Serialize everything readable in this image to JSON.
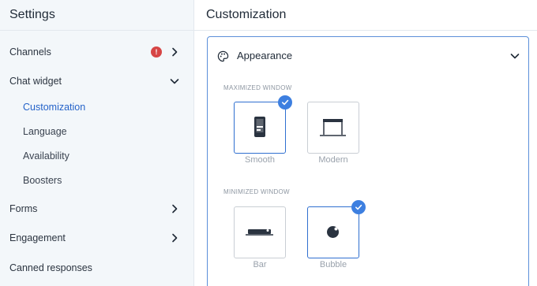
{
  "sidebar": {
    "title": "Settings",
    "items": [
      {
        "label": "Channels",
        "badge": "!"
      },
      {
        "label": "Chat widget"
      },
      {
        "label": "Customization",
        "active": true
      },
      {
        "label": "Language"
      },
      {
        "label": "Availability"
      },
      {
        "label": "Boosters"
      },
      {
        "label": "Forms"
      },
      {
        "label": "Engagement"
      },
      {
        "label": "Canned responses"
      }
    ]
  },
  "main": {
    "title": "Customization",
    "panel": {
      "title": "Appearance",
      "maximized": {
        "label": "MAXIMIZED WINDOW",
        "options": [
          {
            "label": "Smooth",
            "selected": true
          },
          {
            "label": "Modern",
            "selected": false
          }
        ]
      },
      "minimized": {
        "label": "MINIMIZED WINDOW",
        "options": [
          {
            "label": "Bar",
            "selected": false
          },
          {
            "label": "Bubble",
            "selected": true
          }
        ]
      }
    }
  },
  "colors": {
    "accent": "#2563c9",
    "check": "#3d7fe0",
    "badge": "#d64545",
    "sidebar_bg": "#f3f7fa"
  }
}
